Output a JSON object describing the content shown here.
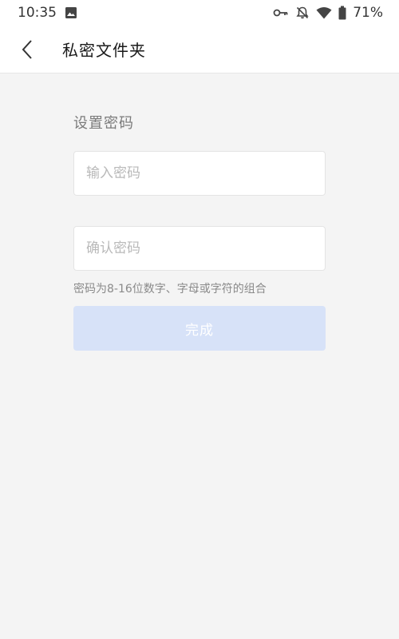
{
  "status_bar": {
    "time": "10:35",
    "battery_percent": "71%",
    "icons": [
      "image-icon",
      "key-icon",
      "bell-off-icon",
      "wifi-icon",
      "battery-icon"
    ]
  },
  "app_bar": {
    "back_icon": "chevron-left-icon",
    "title": "私密文件夹"
  },
  "form": {
    "section_label": "设置密码",
    "password_placeholder": "输入密码",
    "confirm_placeholder": "确认密码",
    "password_value": "",
    "confirm_value": "",
    "hint": "密码为8-16位数字、字母或字符的组合",
    "submit_label": "完成"
  },
  "colors": {
    "background": "#f4f4f4",
    "surface": "#ffffff",
    "button_disabled": "#d7e2f8",
    "hint_text": "#8a8a8a",
    "placeholder": "#b9b9b9"
  }
}
